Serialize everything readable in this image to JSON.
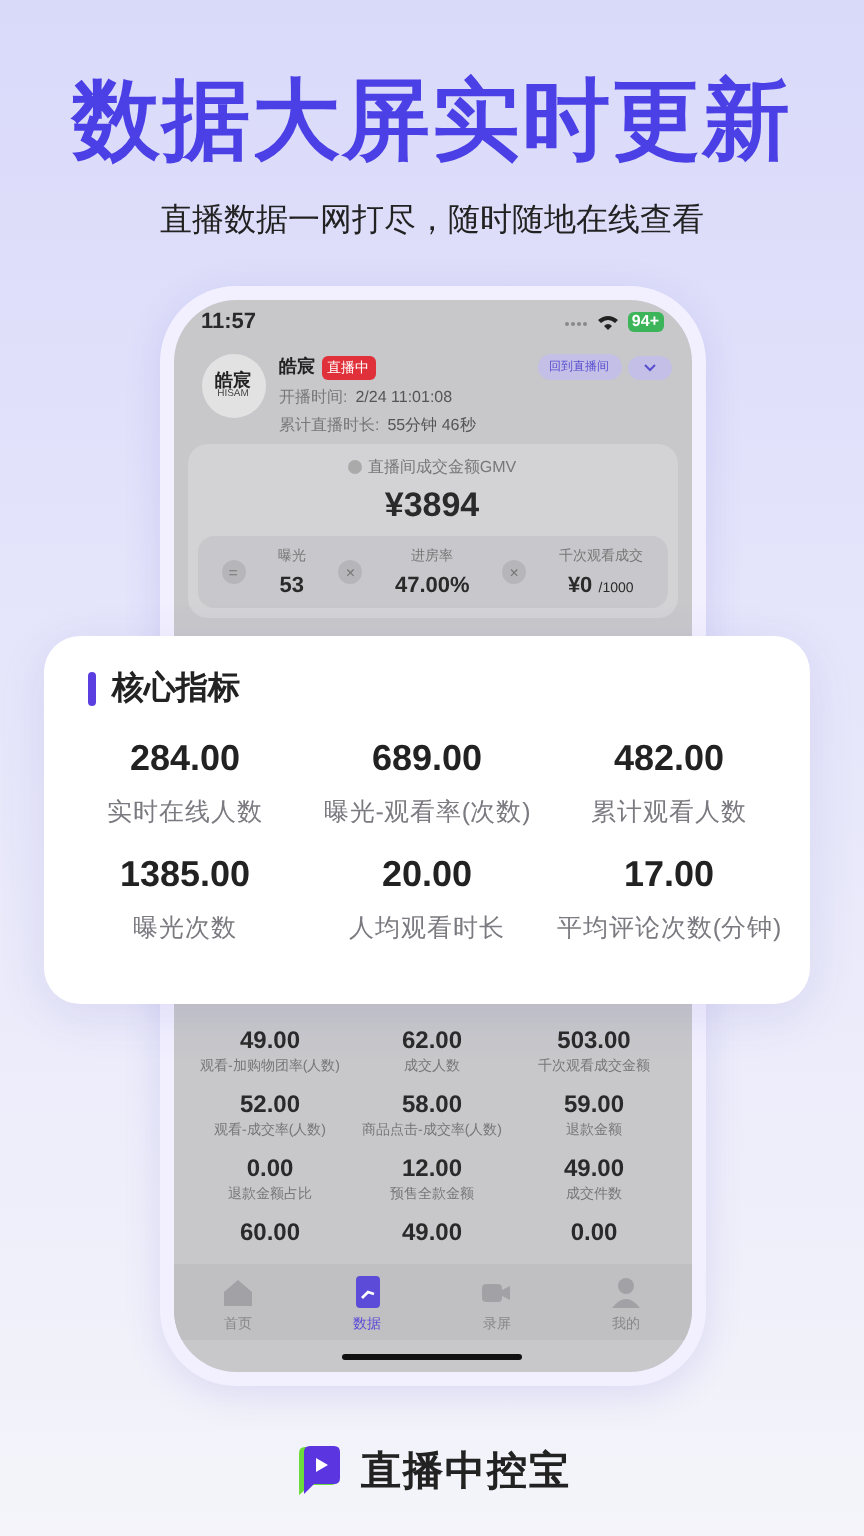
{
  "headline": "数据大屏实时更新",
  "subtitle": "直播数据一网打尽，随时随地在线查看",
  "phone": {
    "status_bar": {
      "time": "11:57",
      "battery": "94+"
    },
    "streamer": {
      "avatar": {
        "line_1": "皓宸",
        "line_2": "HISAM"
      },
      "name": "皓宸",
      "live_badge": "直播中",
      "back_button": "回到直播间",
      "start_time_label": "开播时间:",
      "start_time": "2/24 11:01:08",
      "duration_label": "累计直播时长:",
      "duration": "55分钟 46秒"
    },
    "gmv": {
      "label": "直播间成交金额GMV",
      "value": "¥3894",
      "formula": [
        {
          "kind": "operator",
          "symbol": "="
        },
        {
          "kind": "term",
          "label": "曝光",
          "value": "53"
        },
        {
          "kind": "operator",
          "symbol": "×"
        },
        {
          "kind": "term",
          "label": "进房率",
          "value": "47.00%"
        },
        {
          "kind": "operator",
          "symbol": "×"
        },
        {
          "kind": "term",
          "label": "千次观看成交",
          "value": "¥0",
          "unit": "/1000"
        }
      ]
    },
    "metrics_grid": [
      {
        "value": "49.00",
        "label": "观看-加购物团率(人数)"
      },
      {
        "value": "62.00",
        "label": "成交人数"
      },
      {
        "value": "503.00",
        "label": "千次观看成交金额"
      },
      {
        "value": "52.00",
        "label": "观看-成交率(人数)"
      },
      {
        "value": "58.00",
        "label": "商品点击-成交率(人数)"
      },
      {
        "value": "59.00",
        "label": "退款金额"
      },
      {
        "value": "0.00",
        "label": "退款金额占比"
      },
      {
        "value": "12.00",
        "label": "预售全款金额"
      },
      {
        "value": "49.00",
        "label": "成交件数"
      },
      {
        "value": "60.00"
      },
      {
        "value": "49.00"
      },
      {
        "value": "0.00"
      }
    ],
    "tab_bar": [
      {
        "label": "首页",
        "selected": false
      },
      {
        "label": "数据",
        "selected": true
      },
      {
        "label": "录屏",
        "selected": false
      },
      {
        "label": "我的",
        "selected": false
      }
    ]
  },
  "core_card": {
    "title": "核心指标",
    "metrics": [
      {
        "value": "284.00",
        "label": "实时在线人数"
      },
      {
        "value": "689.00",
        "label": "曝光-观看率(次数)"
      },
      {
        "value": "482.00",
        "label": "累计观看人数"
      },
      {
        "value": "1385.00",
        "label": "曝光次数"
      },
      {
        "value": "20.00",
        "label": "人均观看时长"
      },
      {
        "value": "17.00",
        "label": "平均评论次数(分钟)"
      }
    ]
  },
  "brand": {
    "name": "直播中控宝"
  }
}
